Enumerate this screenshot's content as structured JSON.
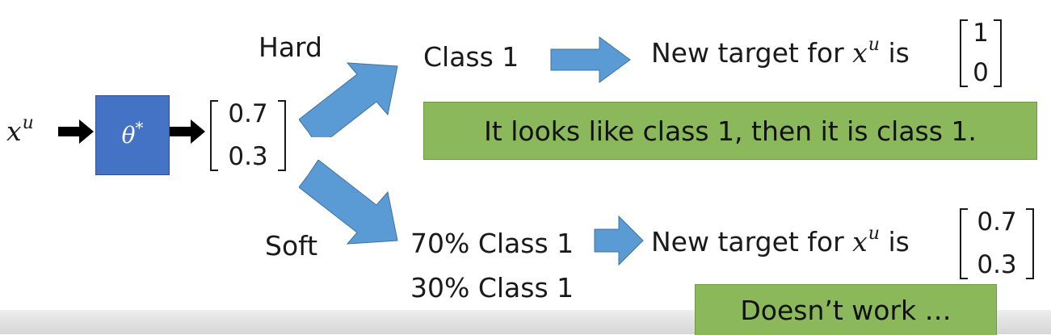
{
  "input": {
    "base": "x",
    "sup": "u"
  },
  "model": {
    "symbol": "θ",
    "sup": "*"
  },
  "output_vector": [
    "0.7",
    "0.3"
  ],
  "hard": {
    "label": "Hard",
    "class_text": "Class 1",
    "target_prefix": "New target for ",
    "target_var": "x",
    "target_sup": "u",
    "target_suffix": " is",
    "target_vector": [
      "1",
      "0"
    ],
    "note": "It looks like class 1, then it is class 1."
  },
  "soft": {
    "label": "Soft",
    "line1": "70% Class 1",
    "line2": "30% Class 1",
    "target_prefix": "New target for ",
    "target_var": "x",
    "target_sup": "u",
    "target_suffix": " is",
    "target_vector": [
      "0.7",
      "0.3"
    ],
    "note": "Doesn’t work …"
  },
  "colors": {
    "arrow_blue": "#5b9bd5",
    "box_blue": "#4472c4",
    "note_green": "#8ab85a"
  }
}
